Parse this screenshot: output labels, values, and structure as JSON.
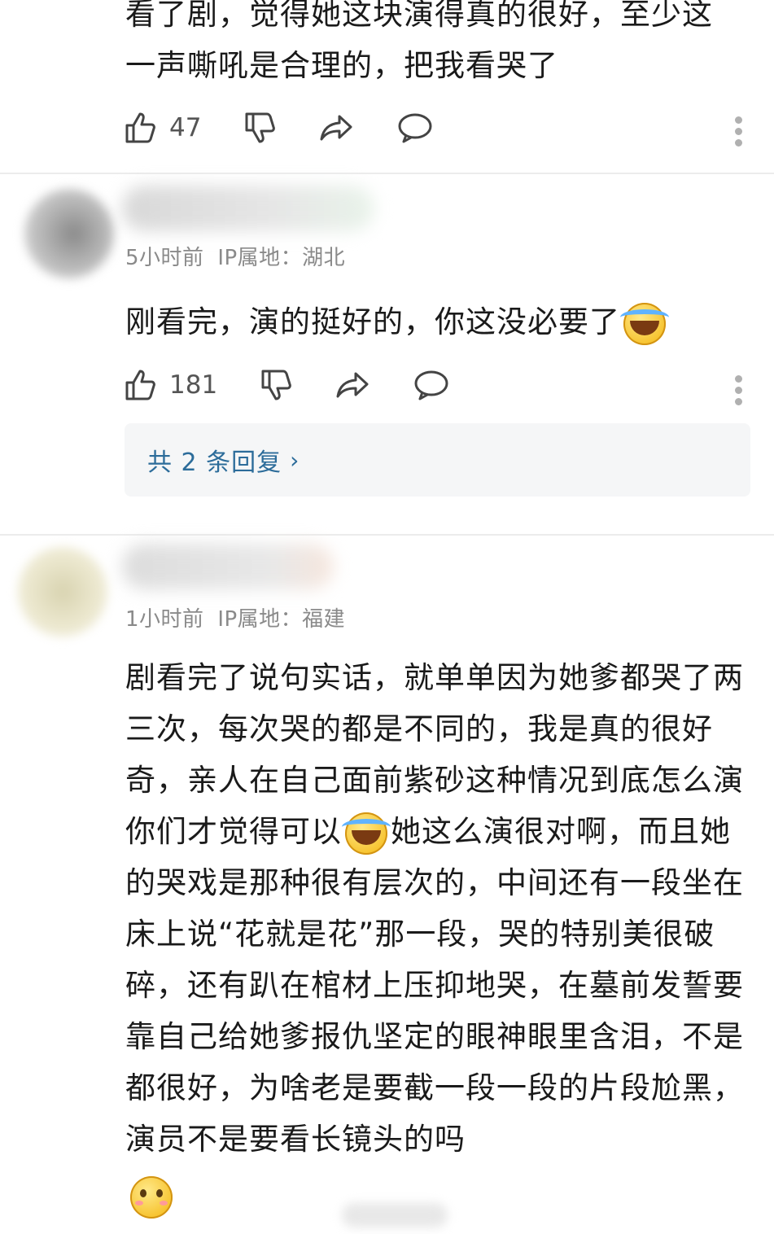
{
  "comments": [
    {
      "body_lines": [
        "看了剧，觉得她这块演得真的很好，至少这",
        "一声嘶吼是合理的，把我看哭了"
      ],
      "like_count": "47"
    },
    {
      "time": "5小时前",
      "ip": "IP属地：湖北",
      "body": "刚看完，演的挺好的，你这没必要了",
      "emoji": "laugh-cry-emoji",
      "like_count": "181",
      "replies_label": "共 2 条回复"
    },
    {
      "time": "1小时前",
      "ip": "IP属地：福建",
      "body_part1": "剧看完了说句实话，就单单因为她爹都哭了两三次，每次哭的都是不同的，我是真的很好奇，亲人在自己面前紫砂这种情况到底怎么演你们才觉得可以",
      "body_part2": "她这么演很对啊，而且她的哭戏是那种很有层次的，中间还有一段坐在床上说“花就是花”那一段，哭的特别美很破碎，还有趴在棺材上压抑地哭，在墓前发誓要靠自己给她爹报仇坚定的眼神眼里含泪，不是都很好，为啥老是要截一段一段的片段尬黑，演员不是要看长镜头的吗",
      "emoji_1": "laugh-cry-emoji",
      "emoji_2": "shy-emoji"
    }
  ],
  "icons": {
    "like": "thumbs-up-icon",
    "dislike": "thumbs-down-icon",
    "share": "share-arrow-icon",
    "reply": "comment-bubble-icon",
    "more": "more-vertical-icon"
  },
  "colors": {
    "reply_link": "#2c6c9a",
    "meta_text": "#8a8a8a",
    "reply_box_bg": "#f5f6f7"
  }
}
